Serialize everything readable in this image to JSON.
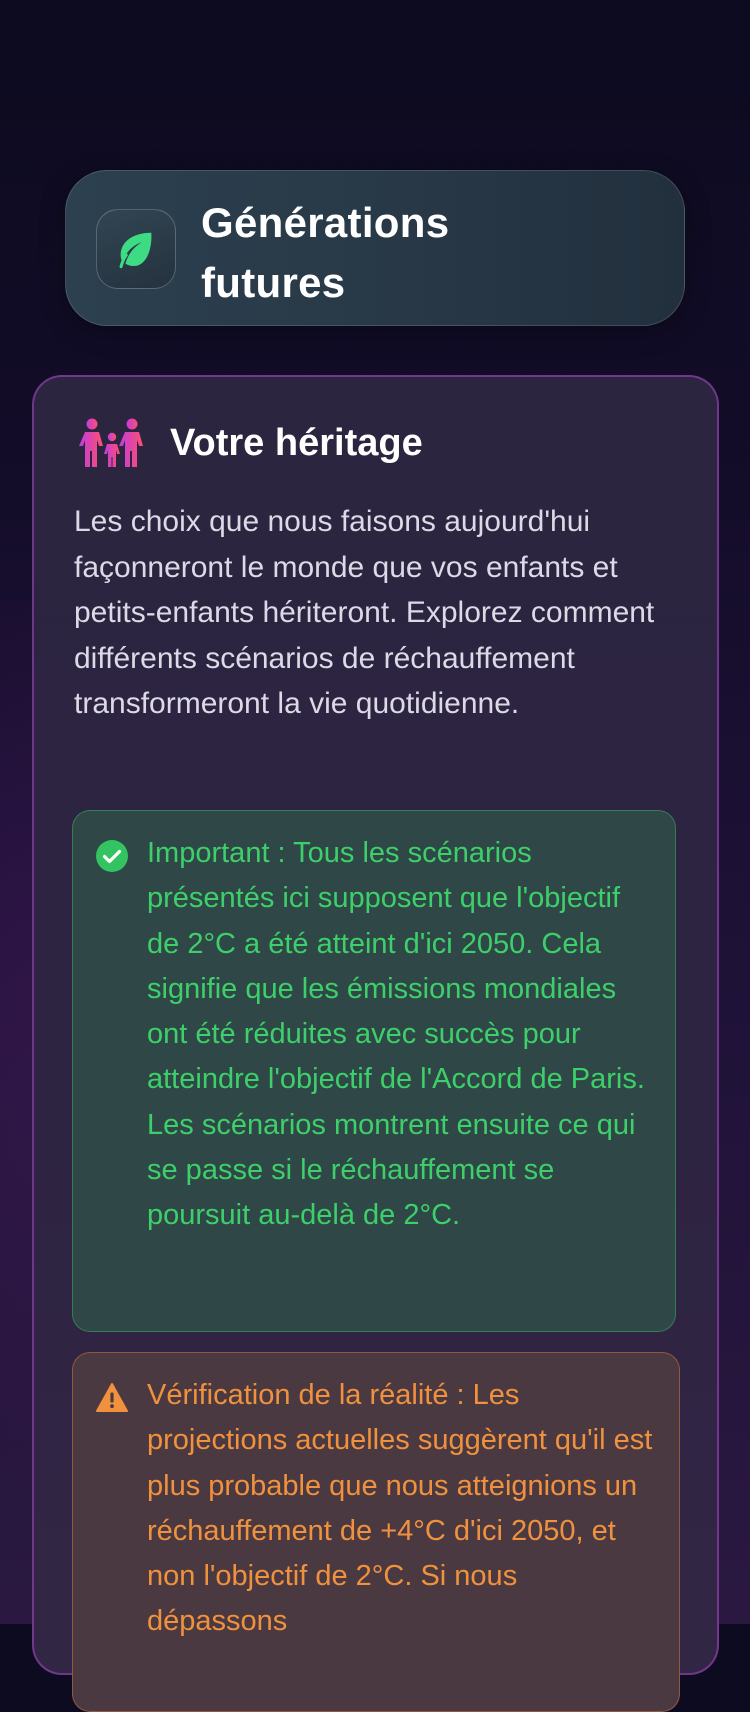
{
  "header": {
    "title": "Générations futures",
    "icon": "leaf-icon",
    "accent": "#3ddc84"
  },
  "section": {
    "title": "Votre héritage",
    "icon": "family-icon",
    "intro": "Les choix que nous faisons aujourd'hui façonneront le monde que vos enfants et petits-enfants hériteront. Explorez comment différents scénarios de réchauffement transformeront la vie quotidienne."
  },
  "notes": {
    "success": {
      "icon": "check-circle-icon",
      "color": "#3dd06a",
      "text": "Important : Tous les scénarios présentés ici supposent que l'objectif de 2°C a été atteint d'ici 2050. Cela signifie que les émissions mondiales ont été réduites avec succès pour atteindre l'objectif de l'Accord de Paris. Les scénarios montrent ensuite ce qui se passe si le réchauffement se poursuit au-delà de 2°C."
    },
    "warning": {
      "icon": "warning-icon",
      "color": "#f0913e",
      "text": "Vérification de la réalité : Les projections actuelles suggèrent qu'il est plus probable que nous atteignions un réchauffement de +4°C d'ici 2050, et non l'objectif de 2°C. Si nous dépassons"
    }
  }
}
